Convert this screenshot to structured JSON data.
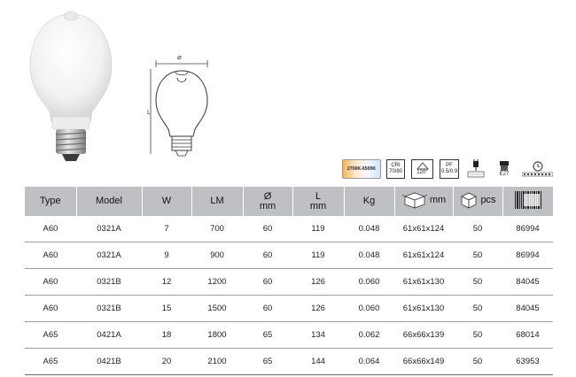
{
  "icon_badges": {
    "cct": "2700K-6500K",
    "cri_label": "CRI",
    "cri_value": "70/80",
    "beam_angle": "120°",
    "pf_label": "PF",
    "pf_value": "0.5/0.9",
    "base": "E27"
  },
  "drawing": {
    "diameter_symbol": "⌀",
    "length_symbol": "L"
  },
  "table": {
    "headers": {
      "type": "Type",
      "model": "Model",
      "watt": "W",
      "lumen": "LM",
      "diameter_symbol": "Ø",
      "diameter_unit": "mm",
      "length_symbol": "L",
      "length_unit": "mm",
      "weight": "Kg",
      "box_unit": "mm",
      "pcs": "pcs"
    },
    "rows": [
      {
        "type": "A60",
        "model": "0321A",
        "w": "7",
        "lm": "700",
        "dia": "60",
        "len": "119",
        "kg": "0.048",
        "box": "61x61x124",
        "pcs": "50",
        "code": "86994"
      },
      {
        "type": "A60",
        "model": "0321A",
        "w": "9",
        "lm": "900",
        "dia": "60",
        "len": "119",
        "kg": "0.048",
        "box": "61x61x124",
        "pcs": "50",
        "code": "86994"
      },
      {
        "type": "A60",
        "model": "0321B",
        "w": "12",
        "lm": "1200",
        "dia": "60",
        "len": "126",
        "kg": "0.060",
        "box": "61x61x130",
        "pcs": "50",
        "code": "84045"
      },
      {
        "type": "A60",
        "model": "0321B",
        "w": "15",
        "lm": "1500",
        "dia": "60",
        "len": "126",
        "kg": "0.060",
        "box": "61x61x130",
        "pcs": "50",
        "code": "84045"
      },
      {
        "type": "A65",
        "model": "0421A",
        "w": "18",
        "lm": "1800",
        "dia": "65",
        "len": "134",
        "kg": "0.062",
        "box": "66x66x139",
        "pcs": "50",
        "code": "68014"
      },
      {
        "type": "A65",
        "model": "0421B",
        "w": "20",
        "lm": "2100",
        "dia": "65",
        "len": "144",
        "kg": "0.064",
        "box": "66x66x149",
        "pcs": "50",
        "code": "63953"
      }
    ]
  },
  "icons": {
    "photo": "led-bulb-sensor-photo",
    "drawing": "bulb-dimension-drawing",
    "box": "package-box-icon",
    "pcs": "carton-box-icon",
    "barcode": "barcode-icon",
    "beam": "beam-angle-icon",
    "voltage": "voltage-plug-icon",
    "base": "e27-base-icon",
    "lifetime": "clock-icon"
  },
  "colors": {
    "header_bg": "#bfc0c3",
    "row_line": "#9c9c9c"
  }
}
